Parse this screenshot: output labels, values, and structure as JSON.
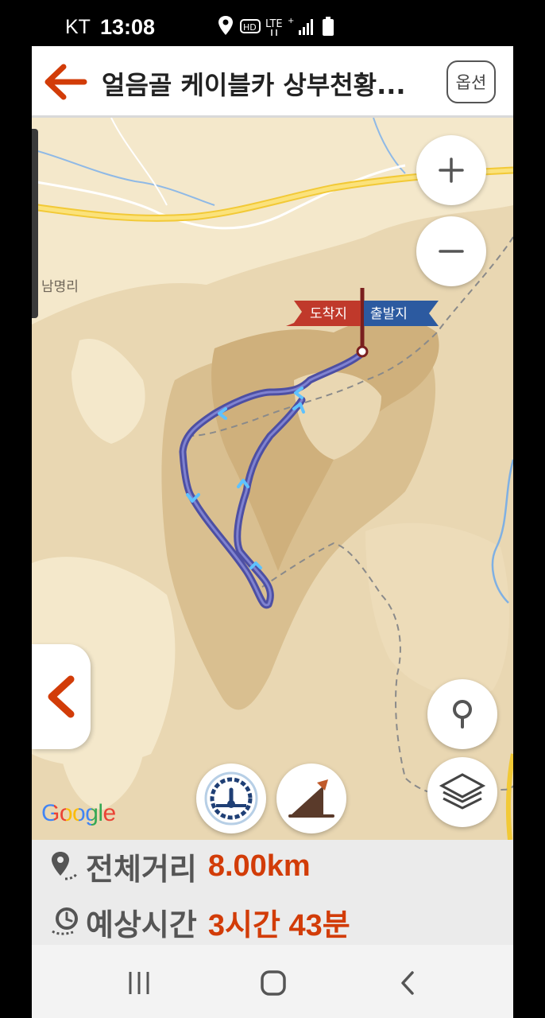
{
  "status_bar": {
    "carrier": "KT",
    "time": "13:08",
    "icons": [
      "location-icon",
      "hd-icon",
      "lte-icon",
      "signal-icon",
      "battery-icon"
    ]
  },
  "header": {
    "title": "얼음골 케이블카 상부천황...",
    "options_label": "옵션"
  },
  "map": {
    "place_label": "남명리",
    "flag_arrival": "도착지",
    "flag_departure": "출발지",
    "attribution": "Google",
    "colors": {
      "route": "#4d4fa3",
      "mountain": "#e3cfa8",
      "road": "#f5d84f",
      "arrival_flag": "#c0392b",
      "departure_flag": "#2c5aa0"
    }
  },
  "summary": {
    "distance_label": "전체거리",
    "distance_value": "8.00km",
    "time_label": "예상시간",
    "time_value": "3시간 43분",
    "accent_color": "#d23c08"
  },
  "nav": {
    "buttons": [
      "recents-icon",
      "home-icon",
      "back-icon"
    ]
  }
}
